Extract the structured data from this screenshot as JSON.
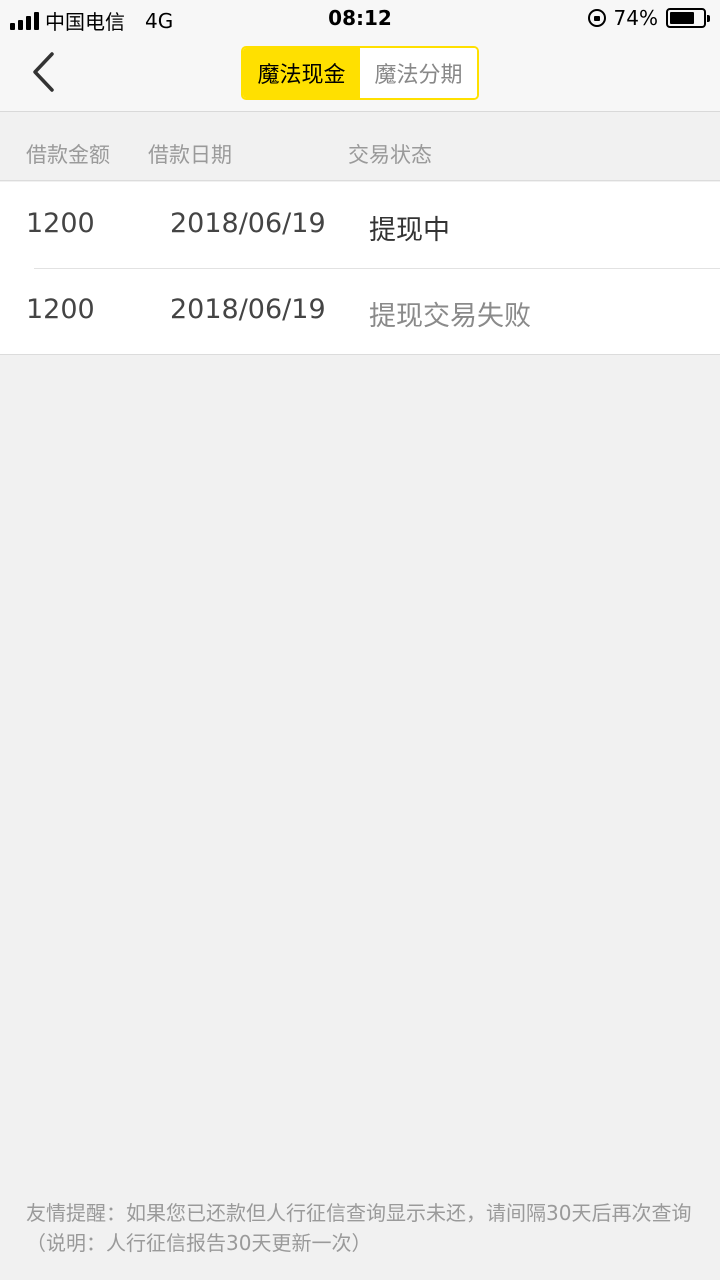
{
  "status_bar": {
    "carrier": "中国电信",
    "network": "4G",
    "time": "08:12",
    "battery_percent": "74%",
    "battery_level": 0.74
  },
  "nav": {
    "back_icon": "chevron-left-icon",
    "tabs": [
      {
        "label": "魔法现金",
        "active": true
      },
      {
        "label": "魔法分期",
        "active": false
      }
    ],
    "accent_color": "#ffe000"
  },
  "table": {
    "headers": [
      "借款金额",
      "借款日期",
      "交易状态"
    ],
    "rows": [
      {
        "amount": "1200",
        "date": "2018/06/19",
        "status": "提现中"
      },
      {
        "amount": "1200",
        "date": "2018/06/19",
        "status": "提现交易失败"
      }
    ]
  },
  "footer": {
    "note": "友情提醒：如果您已还款但人行征信查询显示未还，请间隔30天后再次查询（说明：人行征信报告30天更新一次）"
  }
}
